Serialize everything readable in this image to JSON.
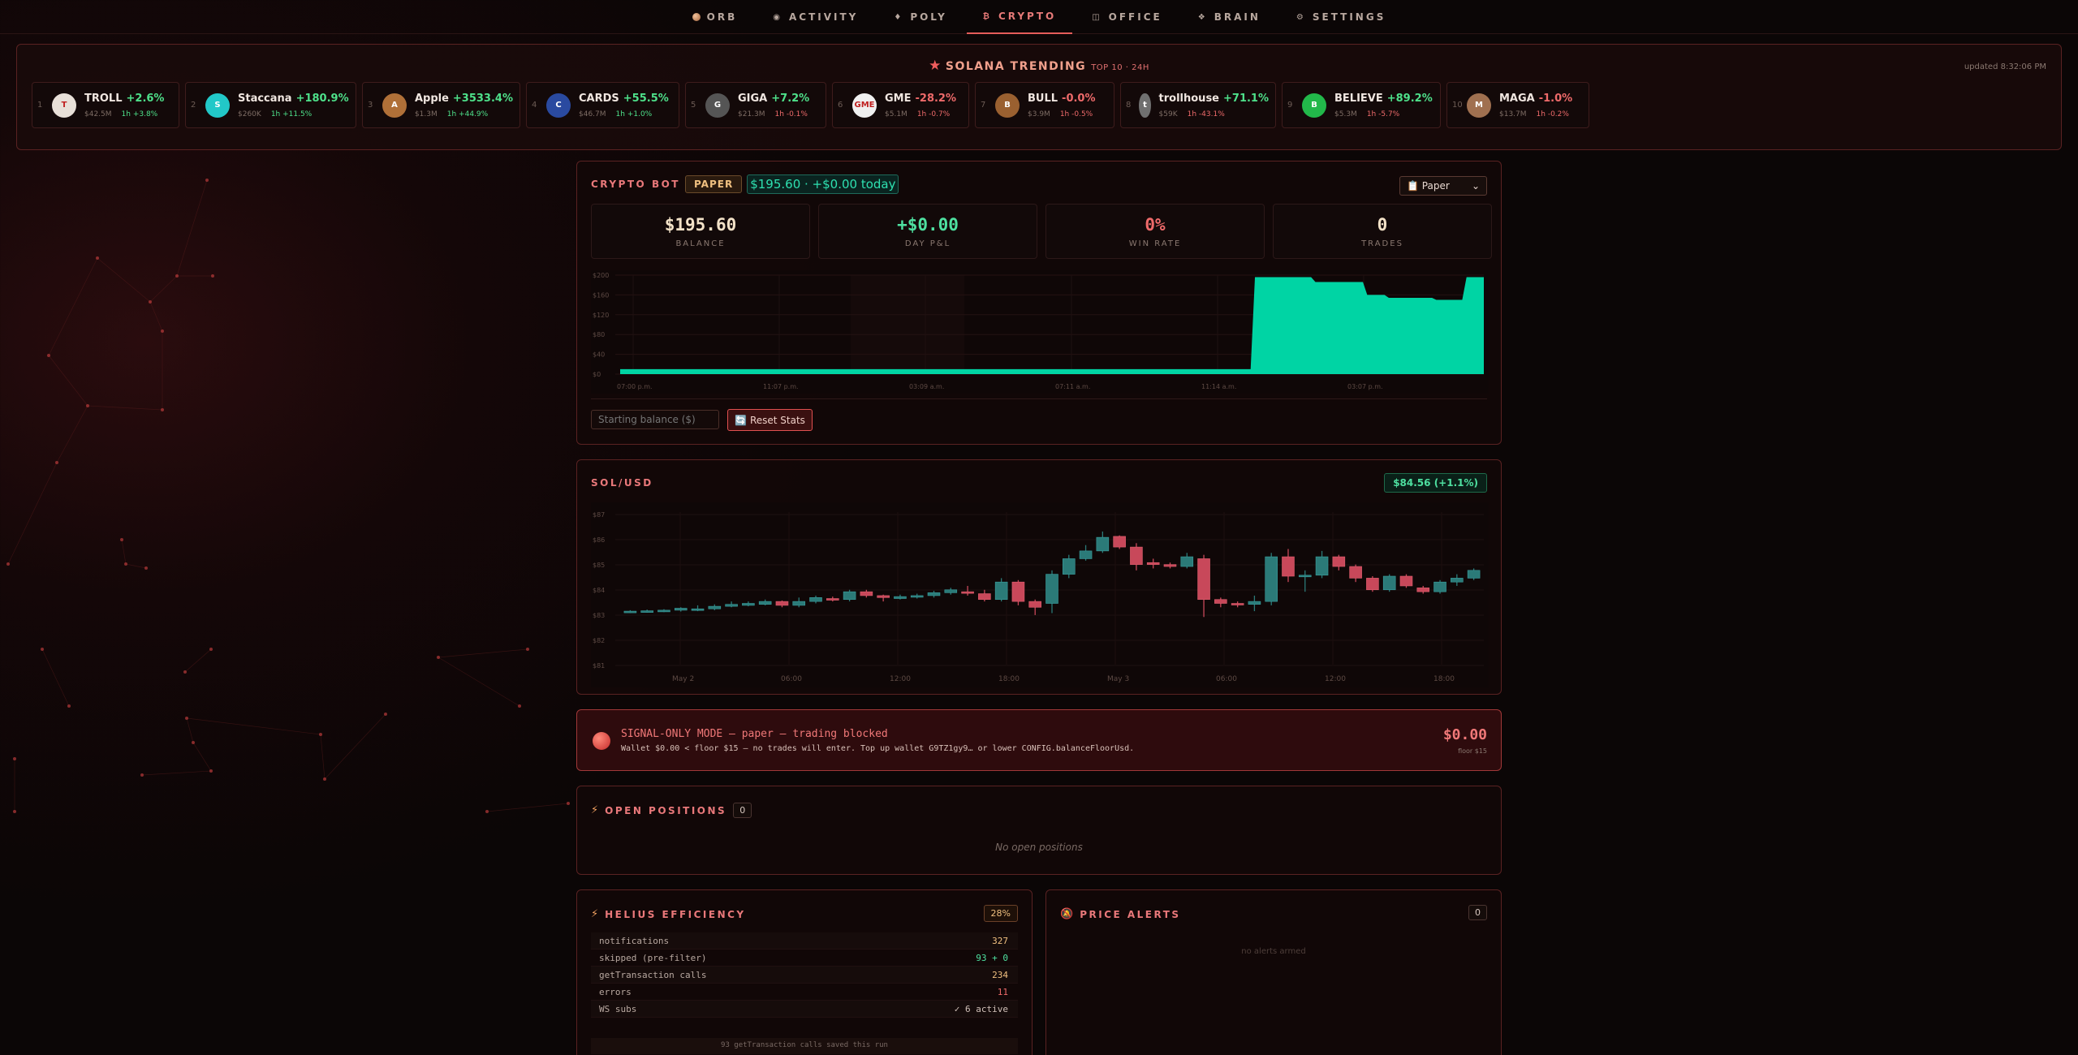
{
  "nav": [
    {
      "icon": "orb-icon",
      "label": "ORB",
      "active": false
    },
    {
      "icon": "activity-icon",
      "glyph": "◉",
      "label": "ACTIVITY",
      "active": false
    },
    {
      "icon": "poly-icon",
      "glyph": "♦",
      "label": "POLY",
      "active": false
    },
    {
      "icon": "bitcoin-icon",
      "glyph": "₿",
      "label": "CRYPTO",
      "active": true
    },
    {
      "icon": "office-icon",
      "glyph": "◫",
      "label": "OFFICE",
      "active": false
    },
    {
      "icon": "brain-icon",
      "glyph": "❖",
      "label": "BRAIN",
      "active": false
    },
    {
      "icon": "gear-icon",
      "glyph": "⚙",
      "label": "SETTINGS",
      "active": false
    }
  ],
  "trending": {
    "title": "SOLANA TRENDING",
    "subtitle": "TOP 10 · 24H",
    "updated": "updated 8:32:06 PM",
    "tokens": [
      {
        "rank": "1",
        "name": "TROLL",
        "change": "+2.6%",
        "up": true,
        "mcap": "$42.5M",
        "h1": "1h +3.8%",
        "h1_up": true,
        "logo_color": "#e8e0d8",
        "logo_text": "T"
      },
      {
        "rank": "2",
        "name": "Staccana",
        "change": "+180.9%",
        "up": true,
        "mcap": "$260K",
        "h1": "1h +11.5%",
        "h1_up": true,
        "logo_color": "#22c8c8",
        "logo_text": "S"
      },
      {
        "rank": "3",
        "name": "Apple",
        "change": "+3533.4%",
        "up": true,
        "mcap": "$1.3M",
        "h1": "1h +44.9%",
        "h1_up": true,
        "logo_color": "#b07038",
        "logo_text": "A"
      },
      {
        "rank": "4",
        "name": "CARDS",
        "change": "+55.5%",
        "up": true,
        "mcap": "$46.7M",
        "h1": "1h +1.0%",
        "h1_up": true,
        "logo_color": "#2a4aa0",
        "logo_text": "C"
      },
      {
        "rank": "5",
        "name": "GIGA",
        "change": "+7.2%",
        "up": true,
        "mcap": "$21.3M",
        "h1": "1h -0.1%",
        "h1_up": false,
        "logo_color": "#555555",
        "logo_text": "G"
      },
      {
        "rank": "6",
        "name": "GME",
        "change": "-28.2%",
        "up": false,
        "mcap": "$5.1M",
        "h1": "1h -0.7%",
        "h1_up": false,
        "logo_color": "#f0f0f0",
        "logo_text": "GME"
      },
      {
        "rank": "7",
        "name": "BULL",
        "change": "-0.0%",
        "up": false,
        "mcap": "$3.9M",
        "h1": "1h -0.5%",
        "h1_up": false,
        "logo_color": "#9a6030",
        "logo_text": "B"
      },
      {
        "rank": "8",
        "name": "trollhouse",
        "change": "+71.1%",
        "up": true,
        "mcap": "$59K",
        "h1": "1h -43.1%",
        "h1_up": false,
        "logo_color": "#707070",
        "logo_text": "t"
      },
      {
        "rank": "9",
        "name": "BELIEVE",
        "change": "+89.2%",
        "up": true,
        "mcap": "$5.3M",
        "h1": "1h -5.7%",
        "h1_up": false,
        "logo_color": "#22b84a",
        "logo_text": "B"
      },
      {
        "rank": "10",
        "name": "MAGA",
        "change": "-1.0%",
        "up": false,
        "mcap": "$13.7M",
        "h1": "1h -0.2%",
        "h1_up": false,
        "logo_color": "#a07050",
        "logo_text": "M"
      }
    ]
  },
  "bot": {
    "title": "CRYPTO BOT",
    "mode_badge": "PAPER",
    "balance_badge": "$195.60 · +$0.00 today",
    "mode_select": "Paper",
    "mode_icon": "clipboard-icon",
    "stats": [
      {
        "value": "$195.60",
        "label": "BALANCE",
        "tone": "neutral"
      },
      {
        "value": "+$0.00",
        "label": "DAY P&L",
        "tone": "green"
      },
      {
        "value": "0%",
        "label": "WIN RATE",
        "tone": "red"
      },
      {
        "value": "0",
        "label": "TRADES",
        "tone": "neutral"
      }
    ],
    "balance_placeholder": "Starting balance ($)",
    "reset_label": "Reset Stats",
    "reset_icon": "reset-icon"
  },
  "sol": {
    "title": "SOL/USD",
    "price": "$84.56 (+1.1%)"
  },
  "signal": {
    "title": "SIGNAL-ONLY MODE — paper — trading blocked",
    "message": "Wallet $0.00 < floor $15 — no trades will enter. Top up wallet G9TZ1gy9… or lower CONFIG.balanceFloorUsd.",
    "amount": "$0.00",
    "floor": "floor $15"
  },
  "positions": {
    "title": "OPEN POSITIONS",
    "icon": "lightning-icon",
    "count": "0",
    "empty": "No open positions"
  },
  "helius": {
    "title": "HELIUS EFFICIENCY",
    "icon": "lightning-icon",
    "pct": "28%",
    "rows": [
      {
        "label": "notifications",
        "value": "327",
        "tone": "neutral"
      },
      {
        "label": "skipped (pre-filter)",
        "value": "93 + 0",
        "tone": "green"
      },
      {
        "label": "getTransaction calls",
        "value": "234",
        "tone": "neutral"
      },
      {
        "label": "errors",
        "value": "11",
        "tone": "red"
      },
      {
        "label": "WS subs",
        "value": "✓ 6 active",
        "tone": "muted"
      }
    ],
    "footer": "93 getTransaction calls saved this run"
  },
  "alerts": {
    "title": "PRICE ALERTS",
    "icon": "bell-icon",
    "count": "0",
    "empty": "no alerts armed"
  },
  "chart_data": [
    {
      "type": "area",
      "title": "",
      "x_ticks": [
        "07:00 p.m.",
        "11:07 p.m.",
        "03:09 a.m.",
        "07:11 a.m.",
        "11:14 a.m.",
        "03:07 p.m."
      ],
      "y_ticks": [
        "$0",
        "$40",
        "$80",
        "$120",
        "$160",
        "$200"
      ],
      "ylim": [
        0,
        200
      ],
      "color": "#00d4a4",
      "series": [
        {
          "x": [
            0,
            0.73,
            0.735,
            0.8,
            0.805,
            0.86,
            0.865,
            0.885,
            0.89,
            0.94,
            0.945,
            0.975,
            0.98,
            1.0
          ],
          "values": [
            10,
            10,
            196,
            196,
            186,
            186,
            160,
            160,
            154,
            154,
            150,
            150,
            196,
            196
          ]
        }
      ]
    },
    {
      "type": "candlestick",
      "title": "",
      "x_ticks": [
        "May 2",
        "06:00",
        "12:00",
        "18:00",
        "May 3",
        "06:00",
        "12:00",
        "18:00"
      ],
      "y_ticks": [
        "$87",
        "$86",
        "$85",
        "$84",
        "$83",
        "$82",
        "$81"
      ],
      "ylim": [
        80.6,
        87.2
      ],
      "up_color": "#2b7a78",
      "down_color": "#c8485a",
      "candles": [
        [
          82.05,
          82.1,
          82.15,
          82.0
        ],
        [
          82.1,
          82.12,
          82.18,
          82.02
        ],
        [
          82.1,
          82.15,
          82.2,
          82.05
        ],
        [
          82.15,
          82.25,
          82.3,
          82.08
        ],
        [
          82.2,
          82.22,
          82.4,
          82.1
        ],
        [
          82.22,
          82.35,
          82.45,
          82.15
        ],
        [
          82.35,
          82.45,
          82.6,
          82.3
        ],
        [
          82.4,
          82.5,
          82.6,
          82.35
        ],
        [
          82.45,
          82.6,
          82.7,
          82.4
        ],
        [
          82.6,
          82.4,
          82.65,
          82.3
        ],
        [
          82.4,
          82.6,
          82.8,
          82.3
        ],
        [
          82.6,
          82.8,
          82.9,
          82.5
        ],
        [
          82.75,
          82.7,
          82.85,
          82.6
        ],
        [
          82.7,
          83.1,
          83.2,
          82.6
        ],
        [
          83.1,
          82.9,
          83.2,
          82.8
        ],
        [
          82.9,
          82.8,
          82.95,
          82.6
        ],
        [
          82.75,
          82.85,
          82.95,
          82.7
        ],
        [
          82.85,
          82.9,
          83.0,
          82.75
        ],
        [
          82.9,
          83.05,
          83.15,
          82.8
        ],
        [
          83.05,
          83.2,
          83.3,
          82.95
        ],
        [
          83.1,
          83.05,
          83.4,
          82.9
        ],
        [
          83.0,
          82.7,
          83.2,
          82.6
        ],
        [
          82.7,
          83.6,
          83.8,
          82.6
        ],
        [
          83.6,
          82.6,
          83.7,
          82.4
        ],
        [
          82.6,
          82.3,
          82.7,
          81.9
        ],
        [
          82.5,
          84.0,
          84.2,
          82.0
        ],
        [
          84.0,
          84.8,
          85.0,
          83.8
        ],
        [
          84.8,
          85.2,
          85.5,
          84.7
        ],
        [
          85.2,
          85.9,
          86.2,
          85.1
        ],
        [
          85.95,
          85.4,
          86.0,
          85.3
        ],
        [
          85.4,
          84.5,
          85.6,
          84.2
        ],
        [
          84.6,
          84.5,
          84.8,
          84.3
        ],
        [
          84.5,
          84.4,
          84.6,
          84.3
        ],
        [
          84.4,
          84.9,
          85.1,
          84.3
        ],
        [
          84.8,
          82.7,
          85.0,
          81.8
        ],
        [
          82.7,
          82.5,
          82.8,
          82.3
        ],
        [
          82.5,
          82.45,
          82.6,
          82.3
        ],
        [
          82.45,
          82.6,
          82.9,
          82.1
        ],
        [
          82.6,
          84.9,
          85.1,
          82.4
        ],
        [
          84.9,
          83.9,
          85.3,
          83.6
        ],
        [
          83.9,
          83.95,
          84.2,
          83.1
        ],
        [
          83.95,
          84.9,
          85.2,
          83.8
        ],
        [
          84.9,
          84.4,
          85.0,
          84.2
        ],
        [
          84.4,
          83.8,
          84.5,
          83.6
        ],
        [
          83.8,
          83.2,
          83.9,
          83.1
        ],
        [
          83.2,
          83.9,
          84.0,
          83.1
        ],
        [
          83.9,
          83.4,
          84.0,
          83.3
        ],
        [
          83.3,
          83.1,
          83.4,
          83.0
        ],
        [
          83.1,
          83.6,
          83.7,
          83.0
        ],
        [
          83.6,
          83.8,
          84.0,
          83.4
        ],
        [
          83.8,
          84.2,
          84.3,
          83.7
        ]
      ]
    }
  ]
}
